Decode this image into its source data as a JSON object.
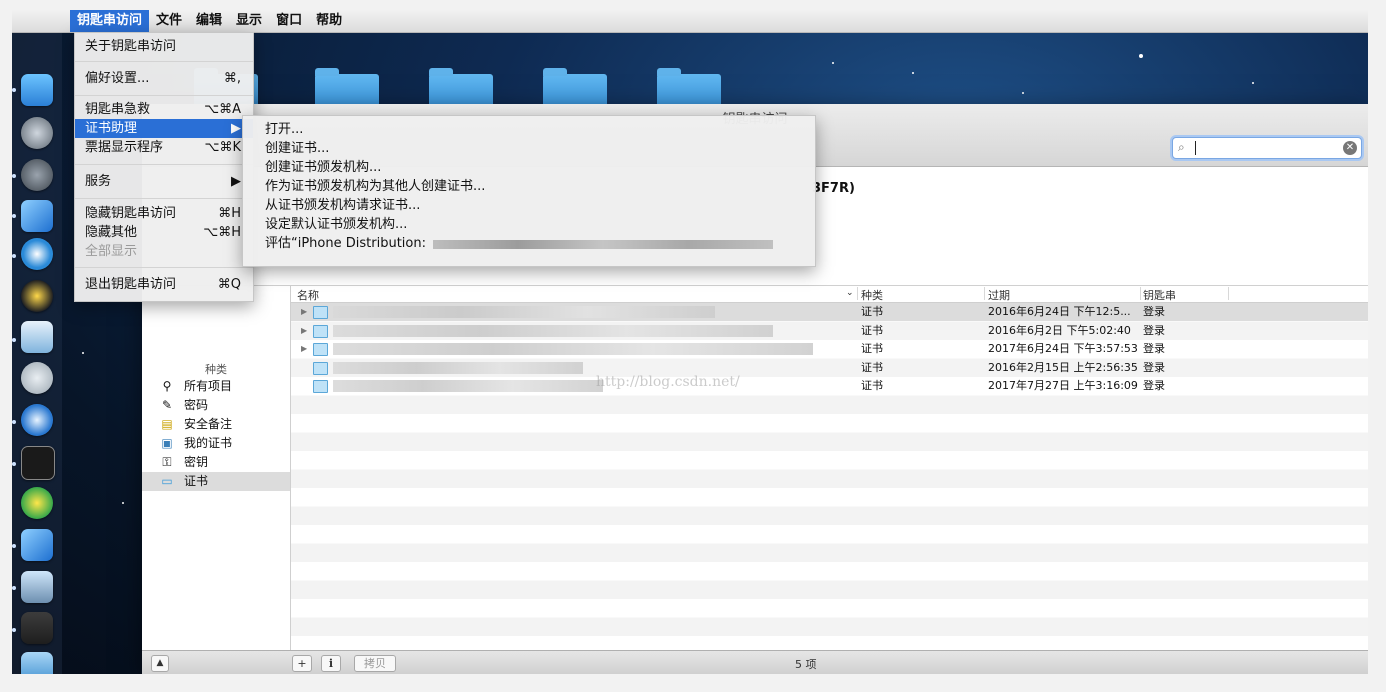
{
  "menubar": {
    "apple": "",
    "items": [
      "钥匙串访问",
      "文件",
      "编辑",
      "显示",
      "窗口",
      "帮助"
    ]
  },
  "app_menu": {
    "items": [
      {
        "label": "关于钥匙串访问",
        "shortcut": ""
      },
      {
        "label": "偏好设置...",
        "shortcut": "⌘,"
      },
      {
        "label": "钥匙串急救",
        "shortcut": "⌥⌘A"
      },
      {
        "label": "证书助理",
        "shortcut": "▶"
      },
      {
        "label": "票据显示程序",
        "shortcut": "⌥⌘K"
      },
      {
        "label": "服务",
        "shortcut": "▶"
      },
      {
        "label": "隐藏钥匙串访问",
        "shortcut": "⌘H"
      },
      {
        "label": "隐藏其他",
        "shortcut": "⌥⌘H"
      },
      {
        "label": "全部显示",
        "shortcut": ""
      },
      {
        "label": "退出钥匙串访问",
        "shortcut": "⌘Q"
      }
    ]
  },
  "cert_submenu": {
    "items": [
      "打开...",
      "创建证书...",
      "创建证书颁发机构...",
      "作为证书颁发机构为其他人创建证书...",
      "从证书颁发机构请求证书...",
      "设定默认证书颁发机构...",
      "评估“iPhone Distribution:"
    ]
  },
  "window": {
    "title": "钥匙串访问",
    "info_fragment": "3F7R)",
    "search": {
      "value": "",
      "clear": "✕",
      "icon": "⌕"
    }
  },
  "sidebar": {
    "header": "种类",
    "items": [
      {
        "label": "所有项目",
        "icon": "⚲"
      },
      {
        "label": "密码",
        "icon": "✎"
      },
      {
        "label": "安全备注",
        "icon": "▤"
      },
      {
        "label": "我的证书",
        "icon": "▣"
      },
      {
        "label": "密钥",
        "icon": "⚿"
      },
      {
        "label": "证书",
        "icon": "▭"
      }
    ]
  },
  "table": {
    "headers": {
      "name": "名称",
      "kind": "种类",
      "expires": "过期",
      "keychain": "钥匙串"
    },
    "rows": [
      {
        "kind": "证书",
        "expires": "2016年6月24日 下午12:5...",
        "keychain": "登录"
      },
      {
        "kind": "证书",
        "expires": "2016年6月2日 下午5:02:40",
        "keychain": "登录"
      },
      {
        "kind": "证书",
        "expires": "2017年6月24日 下午3:57:53",
        "keychain": "登录"
      },
      {
        "kind": "证书",
        "expires": "2016年2月15日 上午2:56:35",
        "keychain": "登录"
      },
      {
        "kind": "证书",
        "expires": "2017年7月27日 上午3:16:09",
        "keychain": "登录"
      }
    ],
    "watermark": "http://blog.csdn.net/"
  },
  "statusbar": {
    "add": "+",
    "info": "i",
    "copy": "拷贝",
    "count": "5 项"
  },
  "colors": {
    "highlight": "#2a6fd6",
    "desktop": "#0e2a52"
  }
}
